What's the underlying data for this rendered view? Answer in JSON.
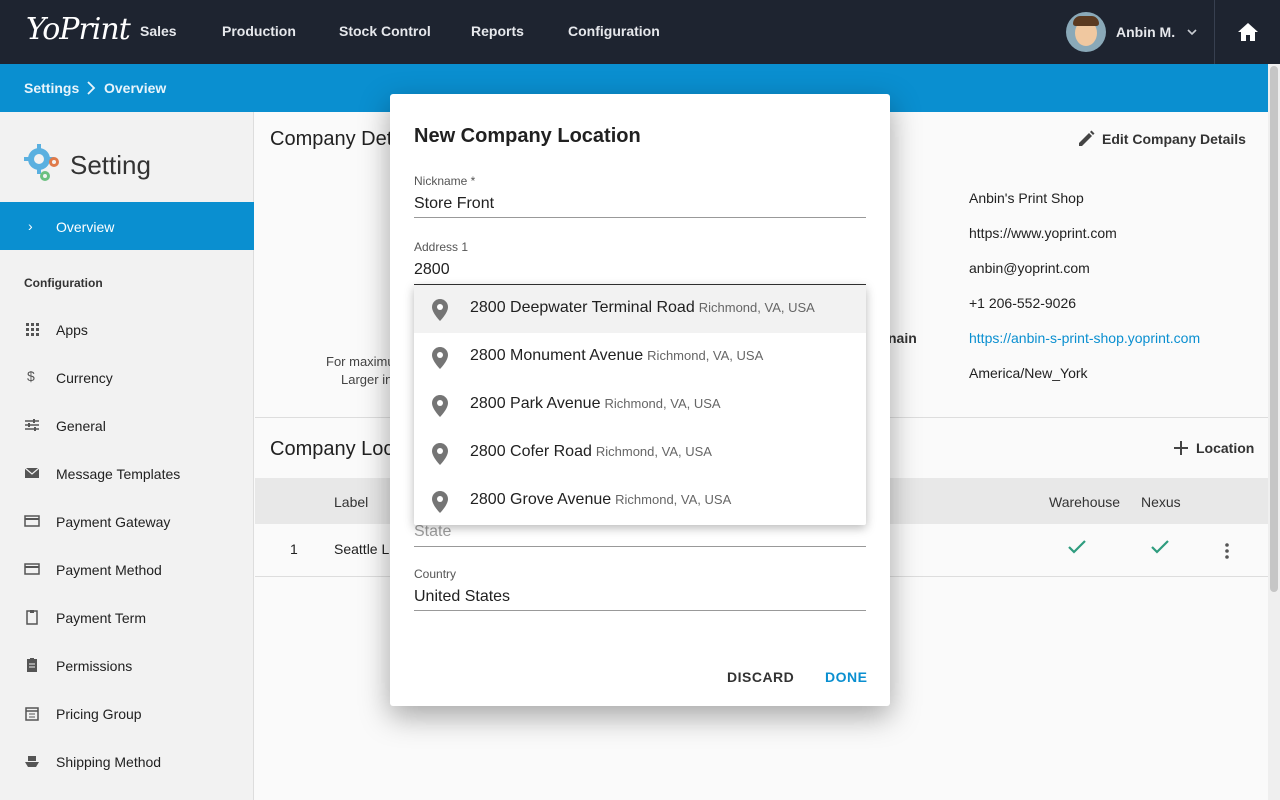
{
  "topbar": {
    "logo": "YoPrint",
    "nav": [
      "Sales",
      "Production",
      "Stock Control",
      "Reports",
      "Configuration"
    ],
    "user_name": "Anbin M."
  },
  "breadcrumb": [
    "Settings",
    "Overview"
  ],
  "sidebar": {
    "title": "Setting",
    "active": "Overview",
    "section": "Configuration",
    "items": [
      {
        "label": "Apps",
        "icon": "grid-icon"
      },
      {
        "label": "Currency",
        "icon": "dollar-icon"
      },
      {
        "label": "General",
        "icon": "sliders-icon"
      },
      {
        "label": "Message Templates",
        "icon": "mail-icon"
      },
      {
        "label": "Payment Gateway",
        "icon": "credit-card-icon"
      },
      {
        "label": "Payment Method",
        "icon": "credit-card-icon"
      },
      {
        "label": "Payment Term",
        "icon": "clipboard-icon"
      },
      {
        "label": "Permissions",
        "icon": "clipboard-list-icon"
      },
      {
        "label": "Pricing Group",
        "icon": "calendar-list-icon"
      },
      {
        "label": "Shipping Method",
        "icon": "ship-icon"
      }
    ]
  },
  "company_details": {
    "title": "Company Det",
    "edit_label": "Edit Company Details",
    "note_line1": "For maximum",
    "note_line2": "Larger in",
    "domain_label_partial": "nain",
    "values": [
      "Anbin's Print Shop",
      "https://www.yoprint.com",
      "anbin@yoprint.com",
      "+1 206-552-9026",
      "https://anbin-s-print-shop.yoprint.com",
      "America/New_York"
    ]
  },
  "company_locations": {
    "title": "Company Loc",
    "add_label": "Location",
    "headers": {
      "label": "Label",
      "warehouse": "Warehouse",
      "nexus": "Nexus"
    },
    "rows": [
      {
        "index": "1",
        "label": "Seattle L"
      }
    ]
  },
  "dialog": {
    "title": "New Company Location",
    "nickname_label": "Nickname *",
    "nickname_value": "Store Front",
    "address1_label": "Address 1",
    "address1_value": "2800",
    "state_placeholder": "State",
    "country_label": "Country",
    "country_value": "United States",
    "discard_label": "DISCARD",
    "done_label": "DONE"
  },
  "suggestions": [
    {
      "main": "2800 Deepwater Terminal Road",
      "sub": "Richmond, VA, USA"
    },
    {
      "main": "2800 Monument Avenue",
      "sub": "Richmond, VA, USA"
    },
    {
      "main": "2800 Park Avenue",
      "sub": "Richmond, VA, USA"
    },
    {
      "main": "2800 Cofer Road",
      "sub": "Richmond, VA, USA"
    },
    {
      "main": "2800 Grove Avenue",
      "sub": "Richmond, VA, USA"
    }
  ],
  "colors": {
    "brand_blue": "#0a8fd0",
    "topbar": "#1e2430",
    "check_green": "#2e9c7e"
  }
}
